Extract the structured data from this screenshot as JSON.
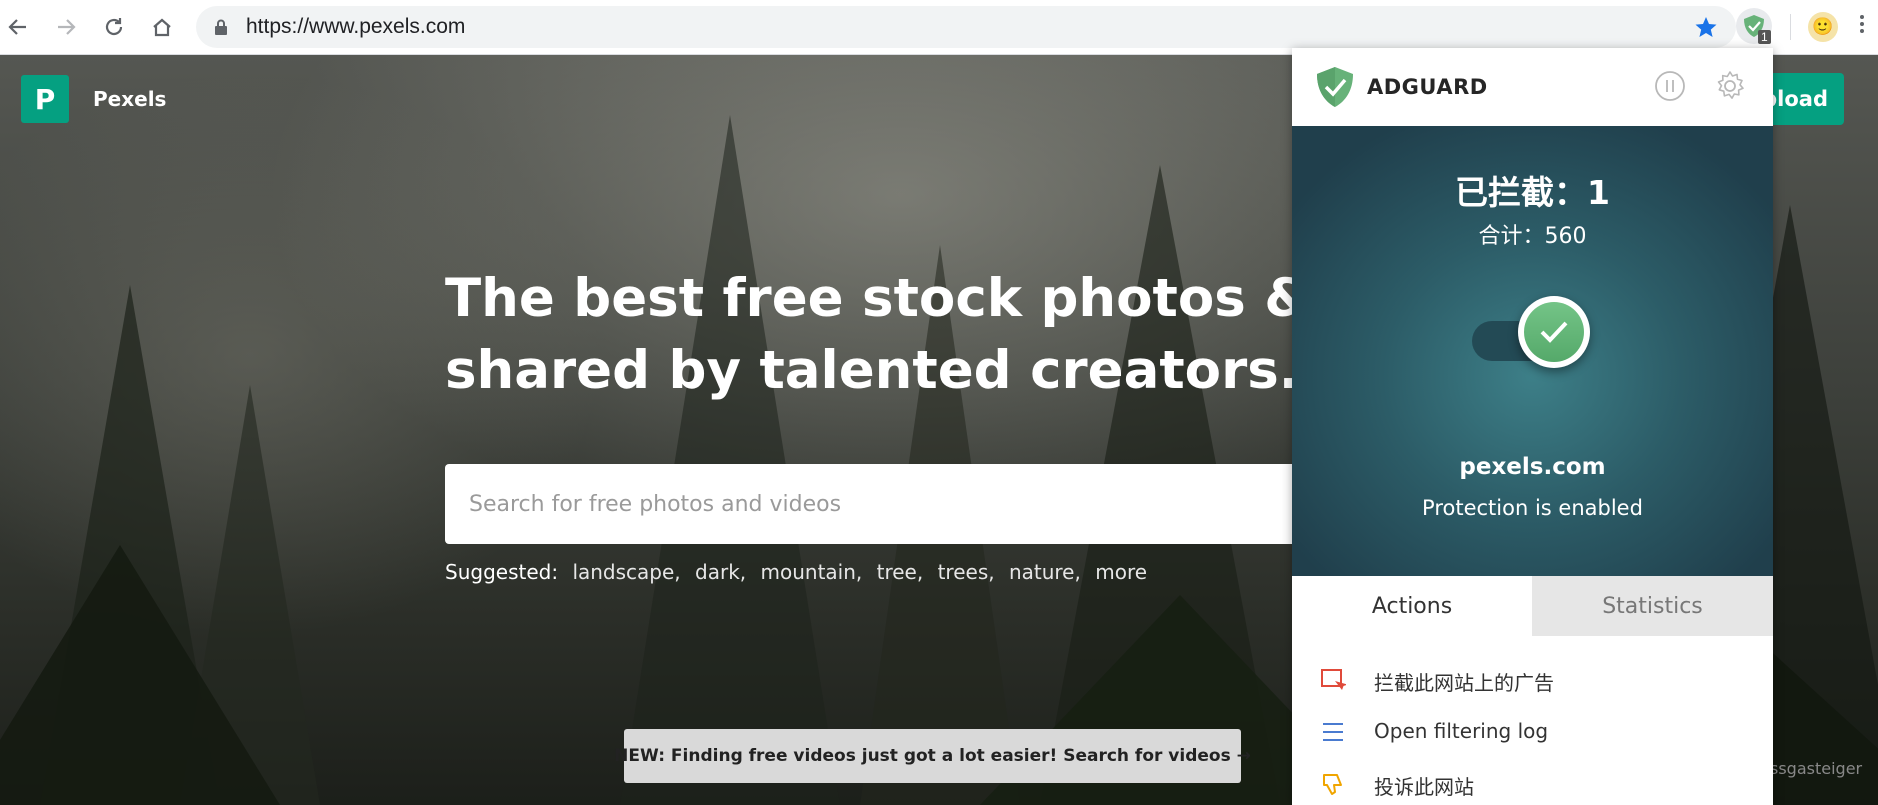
{
  "browser": {
    "url": "https://www.pexels.com",
    "extension_badge": "1",
    "colors": {
      "star": "#1a73e8",
      "adguard_green": "#67b279"
    }
  },
  "page": {
    "logo_letter": "P",
    "logo_text": "Pexels",
    "upload_label": "pload",
    "hero_line1": "The best free stock photos & videos",
    "hero_line2": "shared by talented creators.",
    "search_placeholder": "Search for free photos and videos",
    "suggested_label": "Suggested:",
    "suggested_tags": [
      "landscape,",
      "dark,",
      "mountain,",
      "tree,",
      "trees,",
      "nature,",
      "more"
    ],
    "banner": "NEW: Finding free videos just got a lot easier! Search for videos →",
    "photo_credit": "ssgasteiger",
    "colors": {
      "brand": "#05a081"
    }
  },
  "adguard": {
    "brand": "ADGUARD",
    "blocked": "已拦截：1",
    "total": "合计：560",
    "site": "pexels.com",
    "status": "Protection is enabled",
    "tabs": {
      "actions": "Actions",
      "statistics": "Statistics"
    },
    "actions": [
      {
        "label": "拦截此网站上的广告",
        "icon": "block-ad-icon"
      },
      {
        "label": "Open filtering log",
        "icon": "filtering-log-icon"
      },
      {
        "label": "投诉此网站",
        "icon": "thumbs-down-icon"
      }
    ]
  }
}
